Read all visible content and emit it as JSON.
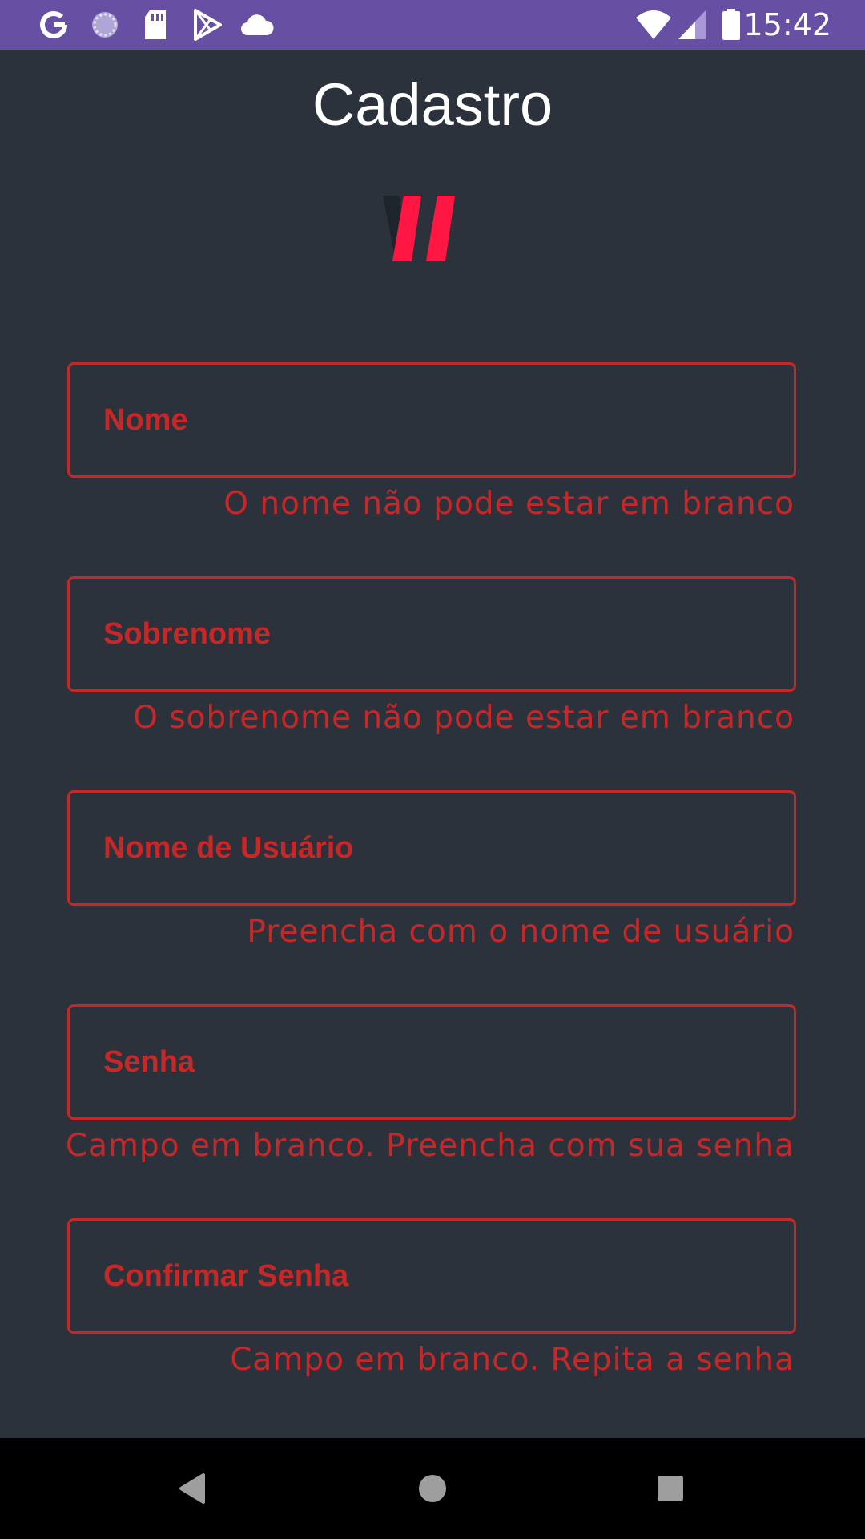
{
  "status_bar": {
    "time": "15:42",
    "left_icons": [
      "google-icon",
      "loading-icon",
      "sd-card-icon",
      "play-store-icon",
      "cloud-icon"
    ],
    "right_icons": [
      "wifi-icon",
      "signal-icon",
      "battery-icon"
    ],
    "background_color": "#6750a4"
  },
  "page": {
    "title": "Cadastro",
    "background_color": "#2b323c",
    "error_color": "#c62828",
    "logo_color": "#ff1744"
  },
  "form": {
    "fields": [
      {
        "label": "Nome",
        "error": "O nome não pode estar em branco"
      },
      {
        "label": "Sobrenome",
        "error": "O sobrenome não pode estar em branco"
      },
      {
        "label": "Nome de Usuário",
        "error": "Preencha com o nome de usuário"
      },
      {
        "label": "Senha",
        "error": "Campo em branco. Preencha com sua senha"
      },
      {
        "label": "Confirmar Senha",
        "error": "Campo em branco. Repita a senha"
      }
    ]
  },
  "nav_bar": {
    "buttons": [
      "back-icon",
      "home-icon",
      "recents-icon"
    ]
  }
}
